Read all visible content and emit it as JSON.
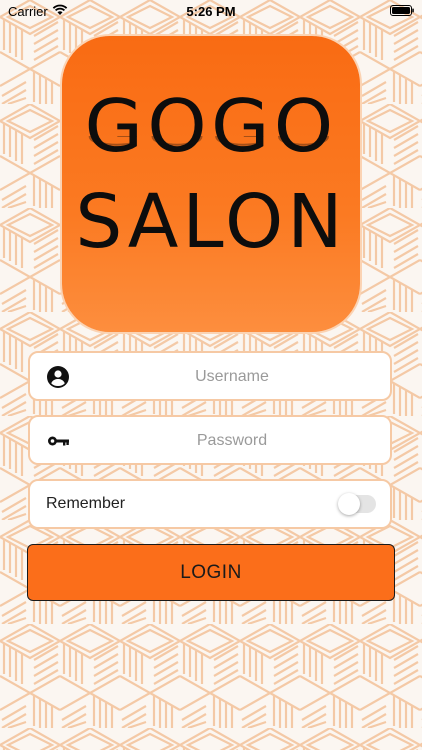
{
  "status_bar": {
    "carrier": "Carrier",
    "time": "5:26 PM"
  },
  "logo": {
    "line1": "GOGO",
    "line2": "SALON"
  },
  "form": {
    "username_placeholder": "Username",
    "password_placeholder": "Password",
    "remember_label": "Remember",
    "remember_on": false
  },
  "login_button": {
    "label": "LOGIN"
  },
  "colors": {
    "accent": "#fb6e1a",
    "pattern": "#f4c9a6",
    "background": "#fbf6f1"
  },
  "icons": {
    "wifi": "wifi-icon",
    "battery": "battery-icon",
    "user": "user-circle-icon",
    "key": "key-icon"
  }
}
